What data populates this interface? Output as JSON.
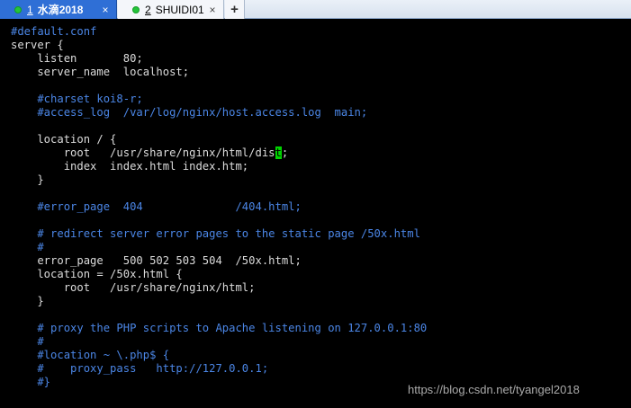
{
  "tabs": [
    {
      "number": "1",
      "title": "水滴2018",
      "close": "×",
      "active": true
    },
    {
      "number": "2",
      "title": "SHUIDI01",
      "close": "×",
      "active": false
    }
  ],
  "new_tab_label": "+",
  "terminal": {
    "lines": [
      {
        "text": "#default.conf",
        "comment": true
      },
      {
        "text": "server {",
        "comment": false
      },
      {
        "text": "    listen       80;",
        "comment": false
      },
      {
        "text": "    server_name  localhost;",
        "comment": false
      },
      {
        "text": "",
        "comment": false
      },
      {
        "text": "    #charset koi8-r;",
        "comment": true
      },
      {
        "text": "    #access_log  /var/log/nginx/host.access.log  main;",
        "comment": true
      },
      {
        "text": "",
        "comment": false
      },
      {
        "text": "    location / {",
        "comment": false
      },
      {
        "text": "        root   /usr/share/nginx/html/dis",
        "cursor": "t",
        "after": ";",
        "comment": false
      },
      {
        "text": "        index  index.html index.htm;",
        "comment": false
      },
      {
        "text": "    }",
        "comment": false
      },
      {
        "text": "",
        "comment": false
      },
      {
        "text": "    #error_page  404              /404.html;",
        "comment": true
      },
      {
        "text": "",
        "comment": false
      },
      {
        "text": "    # redirect server error pages to the static page /50x.html",
        "comment": true
      },
      {
        "text": "    #",
        "comment": true
      },
      {
        "text": "    error_page   500 502 503 504  /50x.html;",
        "comment": false
      },
      {
        "text": "    location = /50x.html {",
        "comment": false
      },
      {
        "text": "        root   /usr/share/nginx/html;",
        "comment": false
      },
      {
        "text": "    }",
        "comment": false
      },
      {
        "text": "",
        "comment": false
      },
      {
        "text": "    # proxy the PHP scripts to Apache listening on 127.0.0.1:80",
        "comment": true
      },
      {
        "text": "    #",
        "comment": true
      },
      {
        "text": "    #location ~ \\.php$ {",
        "comment": true
      },
      {
        "text": "    #    proxy_pass   http://127.0.0.1;",
        "comment": true
      },
      {
        "text": "    #}",
        "comment": true
      }
    ]
  },
  "watermark": "https://blog.csdn.net/tyangel2018",
  "colors": {
    "comment": "#4b86e6",
    "text": "#dcdcdc",
    "cursor": "#00d400",
    "active_tab": "#2f6fd6",
    "tab_dot": "#25c43a"
  }
}
